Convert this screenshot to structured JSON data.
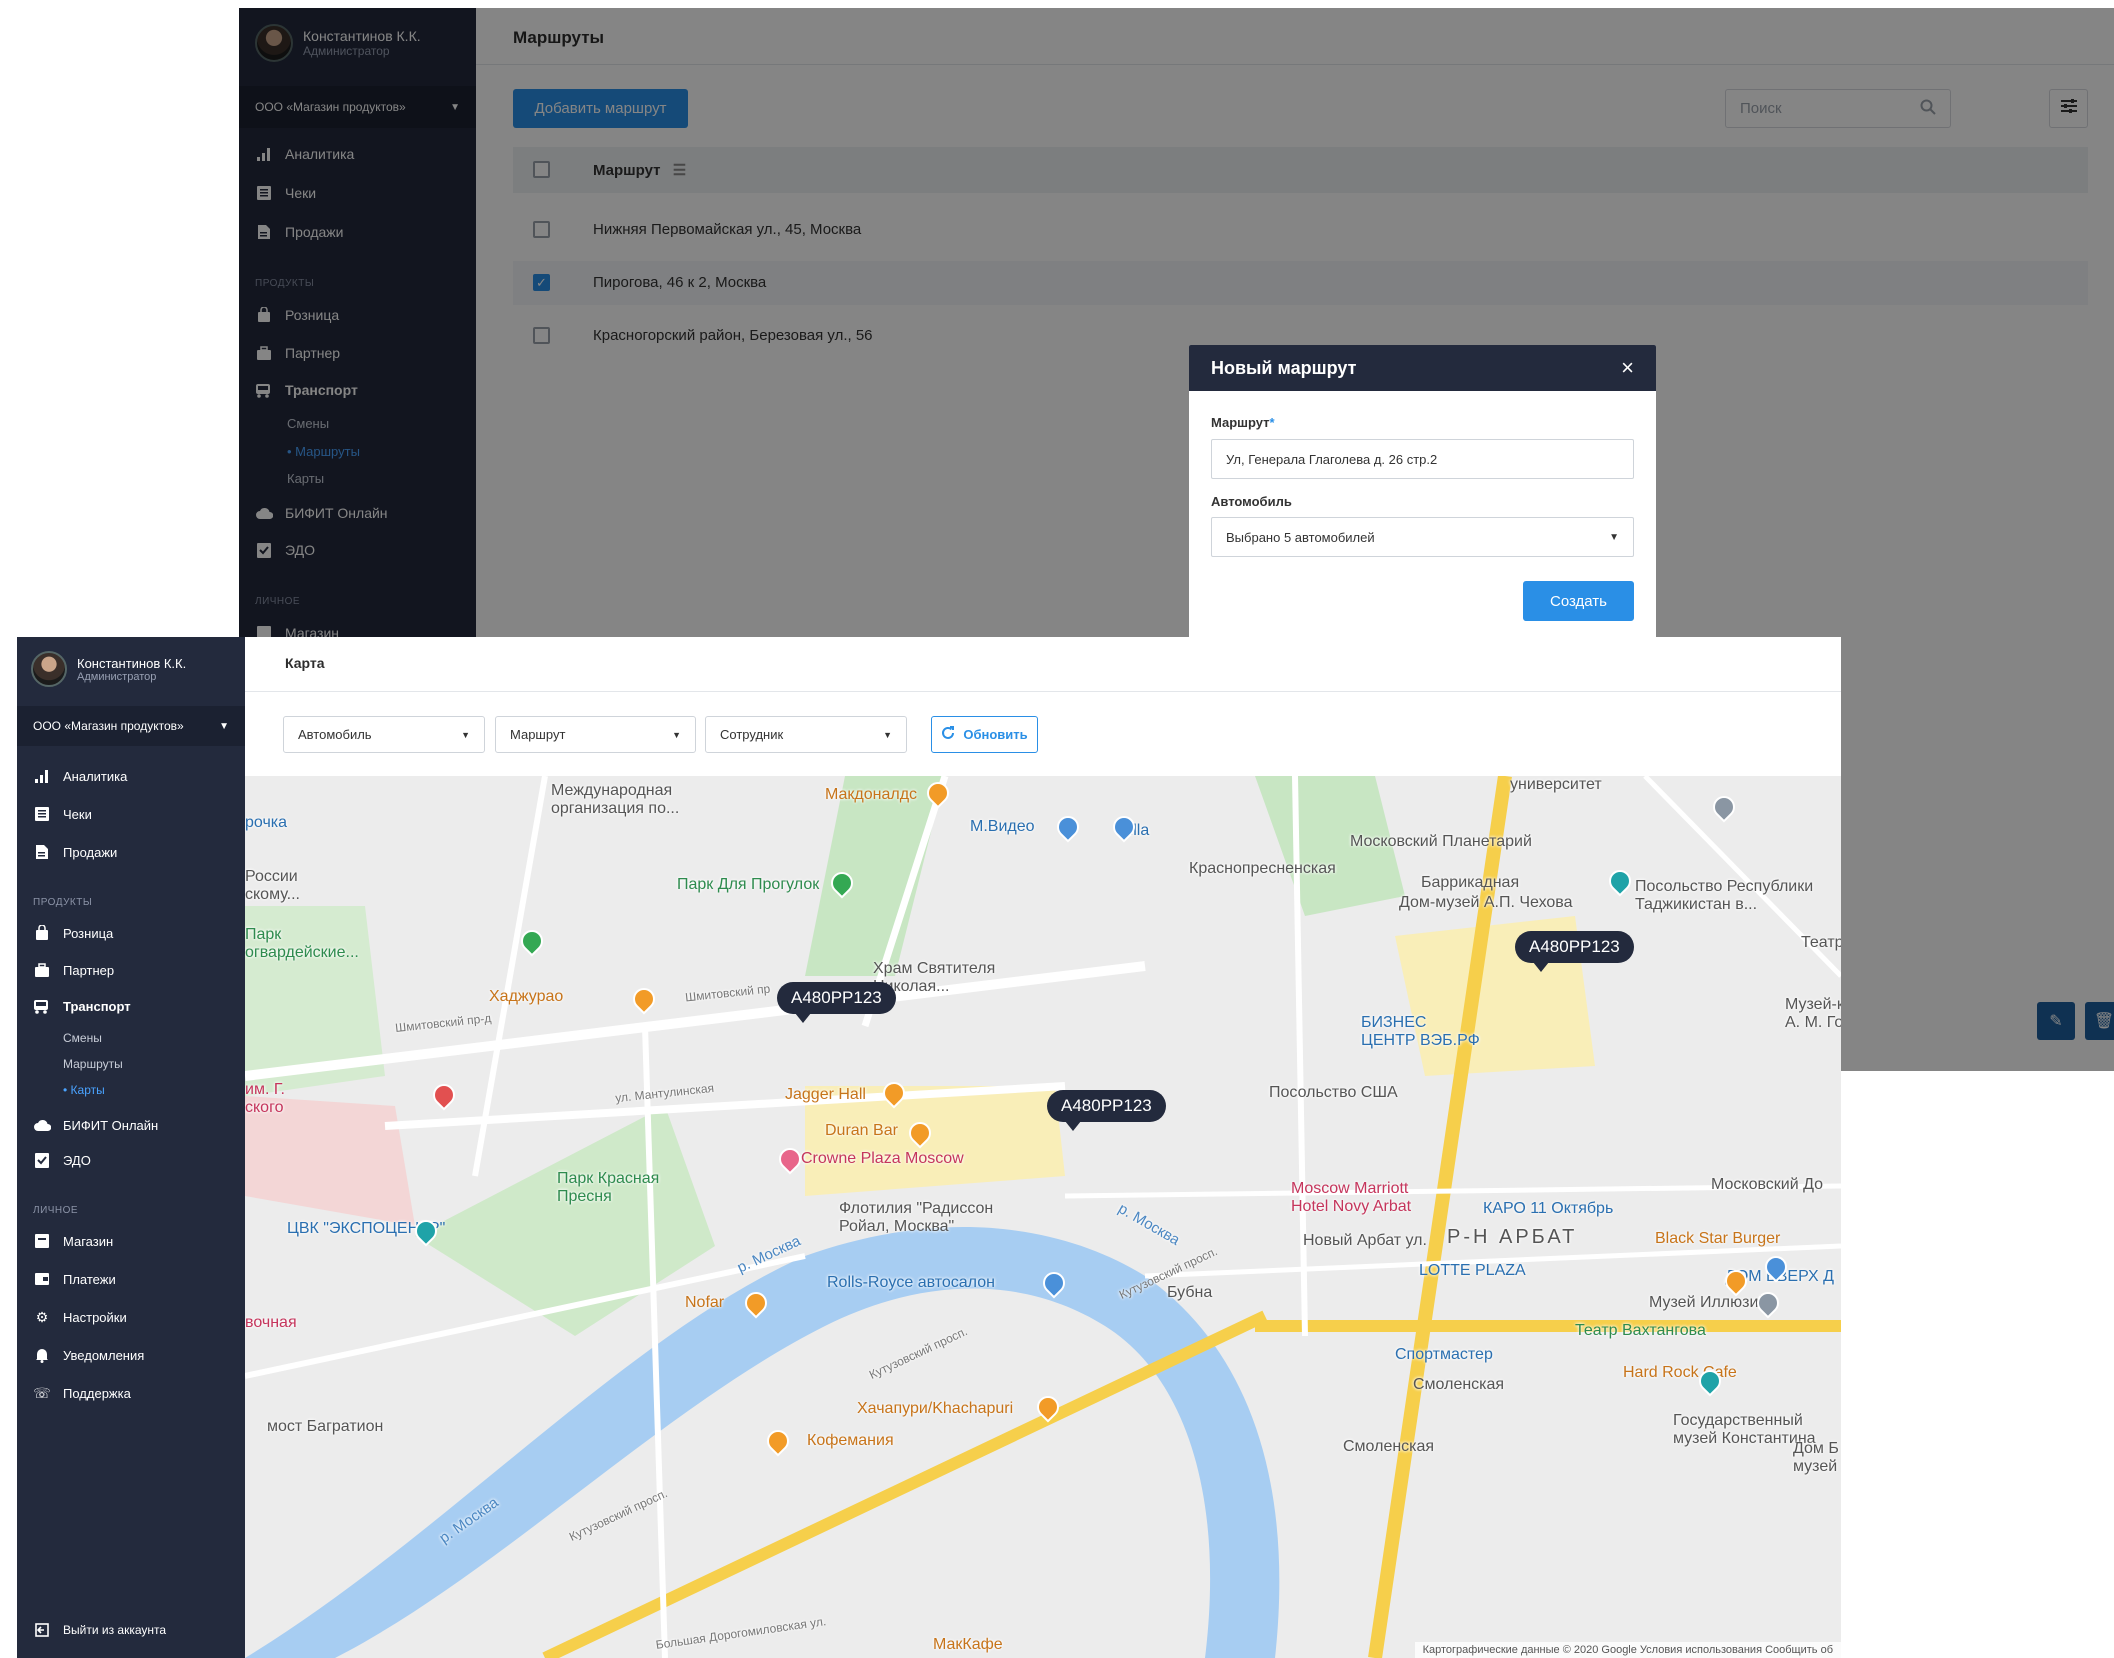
{
  "user": {
    "name": "Константинов К.К.",
    "role": "Администратор"
  },
  "org": "ООО «Магазин продуктов»",
  "back": {
    "nav": [
      {
        "label": "Аналитика",
        "icon": "bar-chart-icon"
      },
      {
        "label": "Чеки",
        "icon": "receipt-icon"
      },
      {
        "label": "Продажи",
        "icon": "document-icon"
      }
    ],
    "section_products": "ПРОДУКТЫ",
    "products": [
      {
        "label": "Розница",
        "icon": "shopping-bag-icon"
      },
      {
        "label": "Партнер",
        "icon": "briefcase-icon"
      },
      {
        "label": "Транспорт",
        "icon": "bus-icon"
      }
    ],
    "transport_sub": [
      "Смены",
      "Маршруты",
      "Карты"
    ],
    "more": [
      {
        "label": "БИФИТ Онлайн",
        "icon": "cloud-icon"
      },
      {
        "label": "ЭДО",
        "icon": "clipboard-check-icon"
      }
    ],
    "section_personal": "ЛИЧНОЕ",
    "personal_first": "Магазин",
    "page_title": "Маршруты",
    "add_button": "Добавить маршрут",
    "search_placeholder": "Поиск",
    "table_header": "Маршрут",
    "rows": [
      {
        "text": "Нижняя Первомайская ул., 45, Москва",
        "checked": false
      },
      {
        "text": "Пирогова, 46 к 2, Москва",
        "checked": true
      },
      {
        "text": "Красногорский район, Березовая ул., 56",
        "checked": false
      }
    ]
  },
  "modal": {
    "title": "Новый маршрут",
    "route_label": "Маршрут",
    "route_required": "*",
    "route_value": "Ул, Генерала Глаголева д. 26 стр.2",
    "car_label": "Автомобиль",
    "car_value": "Выбрано 5 автомобилей",
    "create_button": "Создать"
  },
  "front": {
    "nav": [
      {
        "label": "Аналитика",
        "icon": "bar-chart-icon"
      },
      {
        "label": "Чеки",
        "icon": "receipt-icon"
      },
      {
        "label": "Продажи",
        "icon": "document-icon"
      }
    ],
    "section_products": "ПРОДУКТЫ",
    "products": [
      {
        "label": "Розница",
        "icon": "shopping-bag-icon"
      },
      {
        "label": "Партнер",
        "icon": "briefcase-icon"
      },
      {
        "label": "Транспорт",
        "icon": "bus-icon"
      }
    ],
    "transport_sub": [
      "Смены",
      "Маршруты",
      "Карты"
    ],
    "more": [
      {
        "label": "БИФИТ Онлайн",
        "icon": "cloud-icon"
      },
      {
        "label": "ЭДО",
        "icon": "clipboard-check-icon"
      }
    ],
    "section_personal": "ЛИЧНОЕ",
    "personal": [
      {
        "label": "Магазин",
        "icon": "store-icon"
      },
      {
        "label": "Платежи",
        "icon": "wallet-icon"
      },
      {
        "label": "Настройки",
        "icon": "gear-icon"
      },
      {
        "label": "Уведомления",
        "icon": "bell-icon"
      },
      {
        "label": "Поддержка",
        "icon": "phone-icon"
      }
    ],
    "logout": "Выйти из аккаунта",
    "page_title": "Карта",
    "filters": [
      "Автомобиль",
      "Маршрут",
      "Сотрудник"
    ],
    "refresh": "Обновить"
  },
  "map": {
    "car_tags": [
      "А480РР123",
      "А480РР123",
      "А480РР123"
    ],
    "labels": {
      "intl_org": "Международная\nорганизация по...",
      "mcd": "Макдоналдс",
      "mvideo": "М.Видео",
      "billa": "Billa",
      "univer": "университет",
      "planetarium": "Московский Планетарий",
      "krasnopresn": "Краснопресненская",
      "barrikadnaya": "Баррикадная",
      "chekhov": "Дом-музей А.П. Чехова",
      "embassy_tj": "Посольство Республики\nТаджикистан в...",
      "teatr": "Театр",
      "park_progulok": "Парк Для Прогулок",
      "rossii": "России\nскому...",
      "park_grad": "Парк\nогвардейские...",
      "hram": "Храм Святителя\nНиколая...",
      "khadzhurao": "Хаджурао",
      "biznes": "БИЗНЕС\nЦЕНТР ВЭБ.РФ",
      "muzei_kva": "Музей-ква\nА. М. Гор",
      "jagger": "Jagger Hall",
      "duran": "Duran Bar",
      "posolstvo_usa": "Посольство США",
      "gospital": "им. Г.\nского",
      "crowne": "Crowne Plaza Moscow",
      "park_krasn": "Парк Красная\nПресня",
      "cvk": "ЦВК \"ЭКСПОЦЕНТР\"",
      "flotiliya": "Флотилия \"Радиссон\nРойал, Москва\"",
      "marriott": "Moscow Marriott\nHotel Novy Arbat",
      "karo": "КАРО 11 Октябрь",
      "moskovsky_dom": "Московский До",
      "arbat": "Р-Н АРБАТ",
      "novy_arbat": "Новый Арбат ул.",
      "black_star": "Black Star Burger",
      "lotte": "LOTTE PLAZA",
      "dom_vverkh": "ДОМ ВВЕРХ Д",
      "rolls": "Rolls-Royce автосалон",
      "nofar": "Nofar",
      "bubna": "Бубна",
      "muzei_illyuzii": "Музей Иллюзий",
      "vakhtangov": "Театр Вахтангова",
      "sportmaster": "Спортмастер",
      "smolenskaya": "Смоленская",
      "smolenskaya2": "Смоленская",
      "hard_rock": "Hard Rock Cafe",
      "gos_muzei": "Государственный\nмузей Константина",
      "dom_b": "Дом Б\nмузей",
      "most_bagr": "мост Багратион",
      "khachapuri": "Хачапури/Khachapuri",
      "kofemaniya": "Кофемания",
      "makkafe": "МакКафе",
      "vochnaya": "вочная",
      "erochka": "рочка",
      "river1": "р. Москва",
      "river2": "р. Москва",
      "river3": "р. Москва",
      "kutuz1": "Кутузовский просп.",
      "kutuz2": "Кутузовский просп.",
      "kutuz3": "Кутузовский просп.",
      "shmitov": "Шмитовский пр",
      "shmitov2": "Шмитовский пр-д",
      "mantul": "ул. Мантулинская",
      "bdorog": "Большая Дорогомиловская ул."
    },
    "attribution": "Картографические данные © 2020 Google   Условия использования   Сообщить об"
  }
}
